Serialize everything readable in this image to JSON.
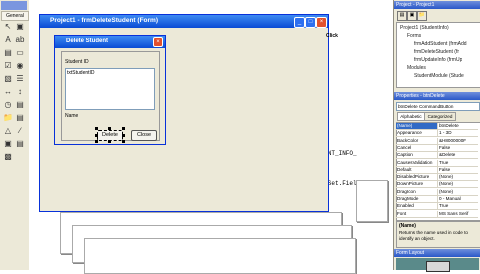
{
  "toolbox": {
    "tab_label": "General",
    "tools": [
      "pointer",
      "picture",
      "label",
      "textbox",
      "frame",
      "command-button",
      "checkbox",
      "option-button",
      "combobox",
      "listbox",
      "hscrollbar",
      "vscrollbar",
      "timer",
      "drive-list",
      "dir-list",
      "file-list",
      "shape",
      "line",
      "image",
      "data",
      "ole"
    ]
  },
  "form_window": {
    "title": "Project1 - frmDeleteStudent (Form)",
    "code_peek_word": "Click"
  },
  "dialog": {
    "title": "Delete Student",
    "label_student_id": "Student ID",
    "textbox_student_id": "txtStudentID",
    "label_name": "Name",
    "btn_delete": "Delete",
    "btn_close": "Close"
  },
  "code_fragments": {
    "line1": "ON STUDENT_INFO_",
    "line2": "bjRecordSet.Fiel"
  },
  "project_explorer": {
    "title": "Project - Project1",
    "root": "Project1 (StudentInfo)",
    "forms_folder": "Forms",
    "forms": [
      "frmAddStudent (frmAdd",
      "frmDeleteStudent (fr",
      "frmUpdateInfo (frmUp"
    ],
    "modules_folder": "Modules",
    "modules": [
      "StudentModule (Stude"
    ]
  },
  "properties": {
    "title": "Properties - btnDelete",
    "object_selector": "btnDelete  CommandButton",
    "tab_alpha": "Alphabetic",
    "tab_cat": "Categorized",
    "rows": [
      {
        "name": "(Name)",
        "value": "btnDelete"
      },
      {
        "name": "Appearance",
        "value": "1 - 3D"
      },
      {
        "name": "BackColor",
        "value": "&H8000000F"
      },
      {
        "name": "Cancel",
        "value": "False"
      },
      {
        "name": "Caption",
        "value": "&Delete"
      },
      {
        "name": "CausesValidation",
        "value": "True"
      },
      {
        "name": "Default",
        "value": "False"
      },
      {
        "name": "DisabledPicture",
        "value": "(None)"
      },
      {
        "name": "DownPicture",
        "value": "(None)"
      },
      {
        "name": "DragIcon",
        "value": "(None)"
      },
      {
        "name": "DragMode",
        "value": "0 - Manual"
      },
      {
        "name": "Enabled",
        "value": "True"
      },
      {
        "name": "Font",
        "value": "MS Sans Serif"
      }
    ],
    "desc_title": "(Name)",
    "desc_text": "Returns the name used in code to identify an object."
  },
  "form_layout": {
    "title": "Form Layout"
  }
}
